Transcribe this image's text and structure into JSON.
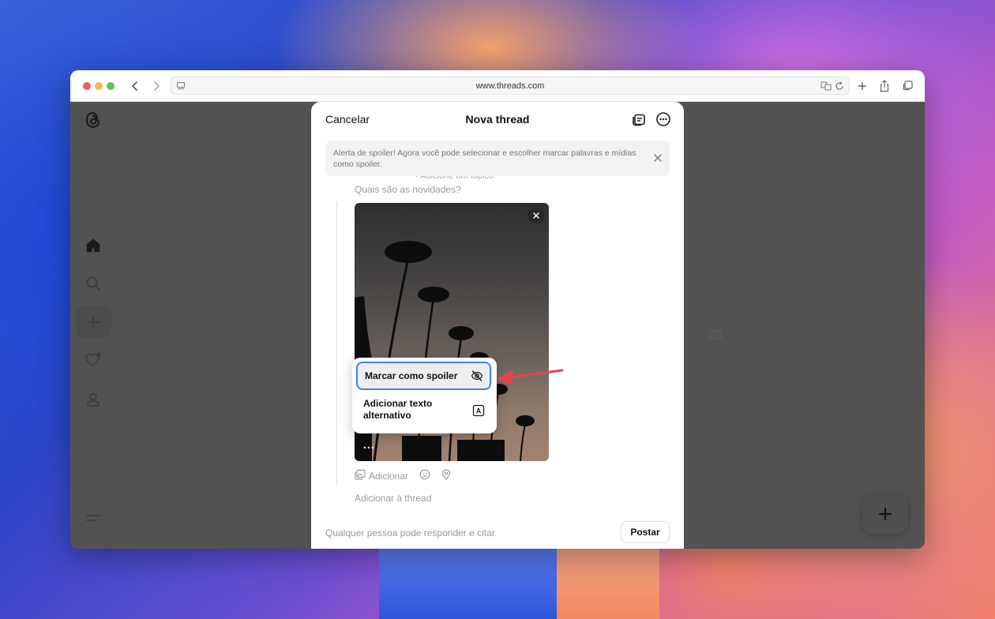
{
  "browser": {
    "url": "www.threads.com"
  },
  "sidebar": {
    "items": [
      {
        "icon": "threads-logo-icon"
      },
      {
        "icon": "home-icon"
      },
      {
        "icon": "search-icon"
      },
      {
        "icon": "plus-icon"
      },
      {
        "icon": "heart-icon"
      },
      {
        "icon": "profile-icon"
      },
      {
        "icon": "menu-icon"
      }
    ]
  },
  "modal": {
    "cancel_label": "Cancelar",
    "title": "Nova thread",
    "banner_text": "Alerta de spoiler! Agora você pode selecionar e escolher marcar palavras e mídias como spoiler.",
    "topic_hint": "Adicione um tópico",
    "placeholder": "Quais são as novidades?",
    "photo_more": "...",
    "popup": {
      "spoiler_label": "Marcar como spoiler",
      "alt_text_label": "Adicionar texto alternativo"
    },
    "add_label": "Adicionar",
    "add_thread_label": "Adicionar à thread",
    "reply_setting": "Qualquer pessoa pode responder e citar",
    "post_label": "Postar"
  },
  "colors": {
    "accent_selected": "#3d82f0",
    "annotation_arrow": "#e5444f"
  }
}
